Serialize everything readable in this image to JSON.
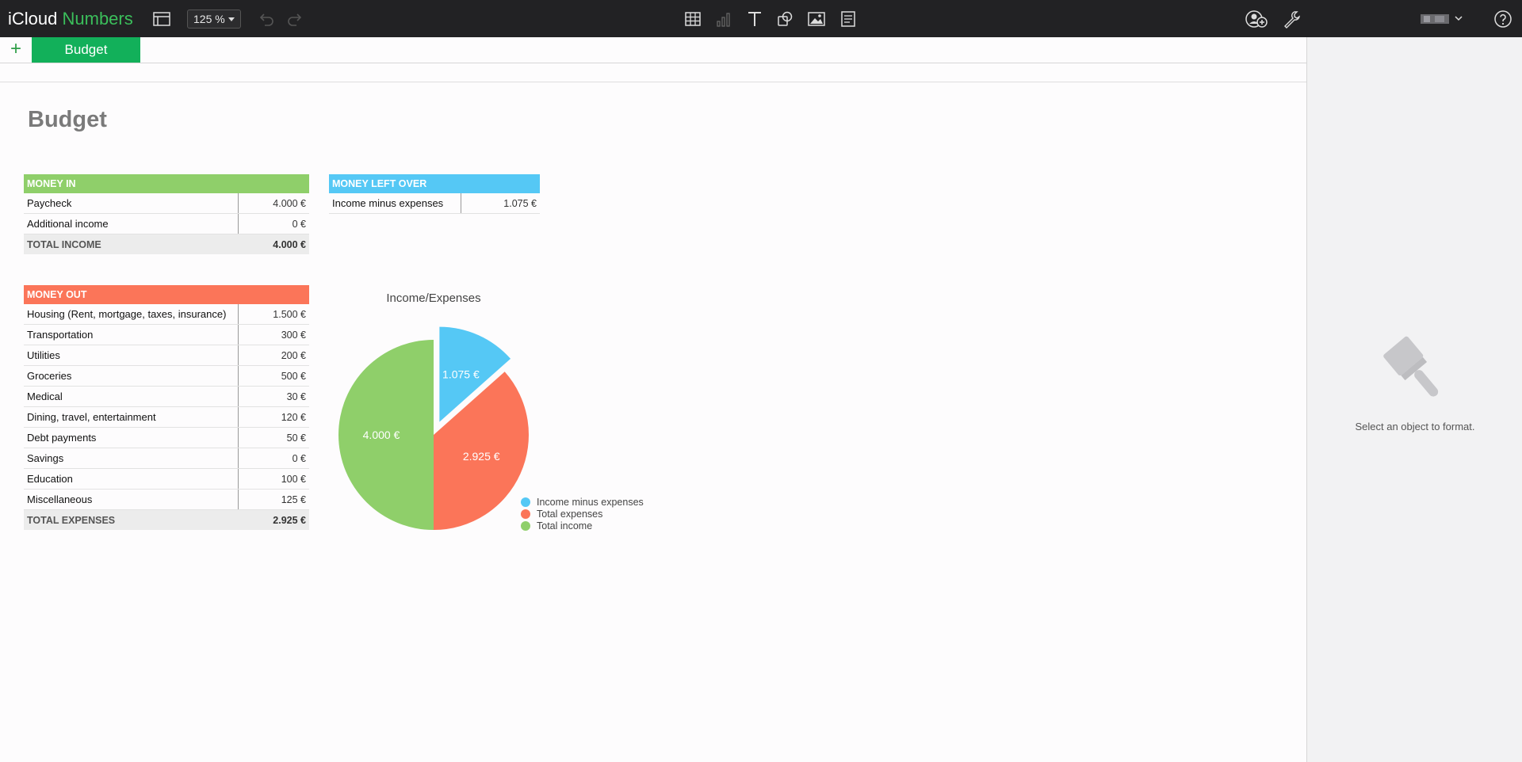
{
  "app": {
    "brand_first": "iCloud",
    "brand_second": "Numbers",
    "zoom": "125 %"
  },
  "toolbar_icons": {
    "view": "sidebar-view-icon",
    "undo": "undo-icon",
    "redo": "redo-icon",
    "table": "table-icon",
    "chart": "chart-icon",
    "text": "text-icon",
    "shape": "shape-icon",
    "media": "image-icon",
    "comment": "comment-icon",
    "collaborate": "add-person-icon",
    "settings": "wrench-icon",
    "account": "account-menu-icon",
    "help": "help-icon"
  },
  "tabs": {
    "add": "+",
    "active": "Budget"
  },
  "sheet": {
    "title": "Budget"
  },
  "money_in": {
    "header": "MONEY IN",
    "rows": [
      {
        "label": "Paycheck",
        "value": "4.000 €"
      },
      {
        "label": "Additional income",
        "value": "0 €"
      }
    ],
    "total_label": "TOTAL INCOME",
    "total_value": "4.000 €"
  },
  "money_left": {
    "header": "MONEY LEFT OVER",
    "rows": [
      {
        "label": "Income minus expenses",
        "value": "1.075 €"
      }
    ]
  },
  "money_out": {
    "header": "MONEY OUT",
    "rows": [
      {
        "label": "Housing (Rent, mortgage, taxes, insurance)",
        "value": "1.500 €"
      },
      {
        "label": "Transportation",
        "value": "300 €"
      },
      {
        "label": "Utilities",
        "value": "200 €"
      },
      {
        "label": "Groceries",
        "value": "500 €"
      },
      {
        "label": "Medical",
        "value": "30 €"
      },
      {
        "label": "Dining, travel, entertainment",
        "value": "120 €"
      },
      {
        "label": "Debt payments",
        "value": "50 €"
      },
      {
        "label": "Savings",
        "value": "0 €"
      },
      {
        "label": "Education",
        "value": "100 €"
      },
      {
        "label": "Miscellaneous",
        "value": "125 €"
      }
    ],
    "total_label": "TOTAL EXPENSES",
    "total_value": "2.925 €"
  },
  "chart_data": {
    "type": "pie",
    "title": "Income/Expenses",
    "slices": [
      {
        "name": "Income minus expenses",
        "value": 1075,
        "label": "1.075 €",
        "color": "#55c8f5",
        "exploded": true
      },
      {
        "name": "Total expenses",
        "value": 2925,
        "label": "2.925 €",
        "color": "#fb7559",
        "exploded": false
      },
      {
        "name": "Total income",
        "value": 4000,
        "label": "4.000 €",
        "color": "#8fcf6a",
        "exploded": false
      }
    ],
    "legend_position": "bottom-right"
  },
  "inspector": {
    "hint": "Select an object to format.",
    "icon": "paintbrush-icon"
  },
  "colors": {
    "money_in": "#8fcf6a",
    "money_left": "#55c8f5",
    "money_out": "#fb7559",
    "tab": "#12b05a"
  }
}
